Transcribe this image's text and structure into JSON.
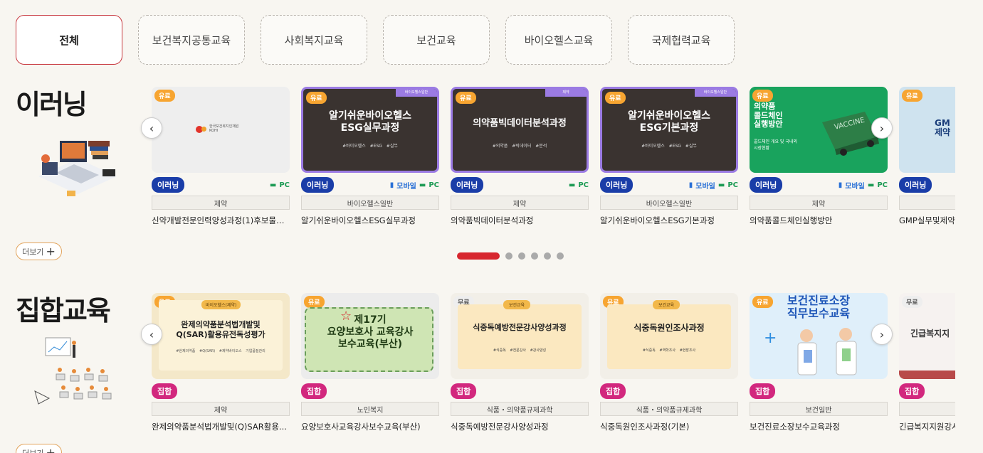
{
  "tabs": [
    "전체",
    "보건복지공통교육",
    "사회복지교육",
    "보건교육",
    "바이오헬스교육",
    "국제협력교육"
  ],
  "elearning": {
    "title": "이러닝",
    "more_label": "더보기",
    "cards": [
      {
        "fee": "유료",
        "type": "이러닝",
        "platform_mobile": "",
        "platform_pc": "PC",
        "category": "제약",
        "title": "신약개발전문인력양성과정(1)후보물질...",
        "thumb_logo": "한국보건복지인재원\nKOHI"
      },
      {
        "fee": "유료",
        "type": "이러닝",
        "platform_mobile": "모바일",
        "platform_pc": "PC",
        "category": "바이오헬스일반",
        "title": "알기쉬운바이오헬스ESG실무과정",
        "thumb_tag": "바이오헬스일반",
        "thumb_title": "알기쉬운바이오헬스\nESG실무과정",
        "thumb_tags": "#바이오헬스 #ESG #실무"
      },
      {
        "fee": "유료",
        "type": "이러닝",
        "platform_mobile": "",
        "platform_pc": "PC",
        "category": "제약",
        "title": "의약품빅데이터분석과정",
        "thumb_tag": "제약",
        "thumb_title": "의약품빅데이터분석과정",
        "thumb_tags": "#의약품 #빅데이터 #분석"
      },
      {
        "fee": "유료",
        "type": "이러닝",
        "platform_mobile": "모바일",
        "platform_pc": "PC",
        "category": "바이오헬스일반",
        "title": "알기쉬운바이오헬스ESG기본과정",
        "thumb_tag": "바이오헬스일반",
        "thumb_title": "알기쉬운바이오헬스\nESG기본과정",
        "thumb_tags": "#바이오헬스 #ESG #실무"
      },
      {
        "fee": "유료",
        "type": "이러닝",
        "platform_mobile": "모바일",
        "platform_pc": "PC",
        "category": "제약",
        "title": "의약품콜드체인실행방안",
        "thumb_title": "의약품\n콜드체인\n실행방안",
        "thumb_sub": "콜드체인 개요 및 국내외\n시장현황"
      },
      {
        "fee": "유료",
        "type": "이러닝",
        "platform_mobile": "",
        "platform_pc": "",
        "category": "",
        "title": "GMP실무및제약",
        "thumb_title": "GM\n제약"
      }
    ]
  },
  "group": {
    "title": "집합교육",
    "more_label": "더보기",
    "cards": [
      {
        "fee": "유료",
        "type": "집합",
        "category": "제약",
        "title": "완제의약품분석법개발및(Q)SAR활용...",
        "thumb_tag": "바이오헬스(제약)",
        "thumb_title": "완제의약품분석법개발및\nQ(SAR)활용유전독성평가",
        "thumb_tags": "#완제의약품 #Q(SAR) #제약바이오스 기업품질관리"
      },
      {
        "fee": "유료",
        "type": "집합",
        "category": "노인복지",
        "title": "요양보호사교육강사보수교육(부산)",
        "thumb_title": "제17기\n요양보호사 교육강사\n보수교육(부산)"
      },
      {
        "fee": "무료",
        "type": "집합",
        "category": "식품・의약품규제과학",
        "title": "식중독예방전문강사양성과정",
        "thumb_tag": "보건교육",
        "thumb_title": "식중독예방전문강사양성과정",
        "thumb_tags": "#식중독 #전문강사 #강사양성"
      },
      {
        "fee": "유료",
        "type": "집합",
        "category": "식품・의약품규제과학",
        "title": "식중독원인조사과정(기본)",
        "thumb_tag": "보건교육",
        "thumb_title": "식중독원인조사과정",
        "thumb_tags": "#식중독 #역학조사 #현장조사"
      },
      {
        "fee": "유료",
        "type": "집합",
        "category": "보건일반",
        "title": "보건진료소장보수교육과정",
        "thumb_title": "보건진료소장\n직무보수교육"
      },
      {
        "fee": "무료",
        "type": "집합",
        "category": "",
        "title": "긴급복지지원강사...",
        "thumb_title": "긴급복지지"
      }
    ]
  },
  "pagination": {
    "count": 6,
    "active": 0
  }
}
